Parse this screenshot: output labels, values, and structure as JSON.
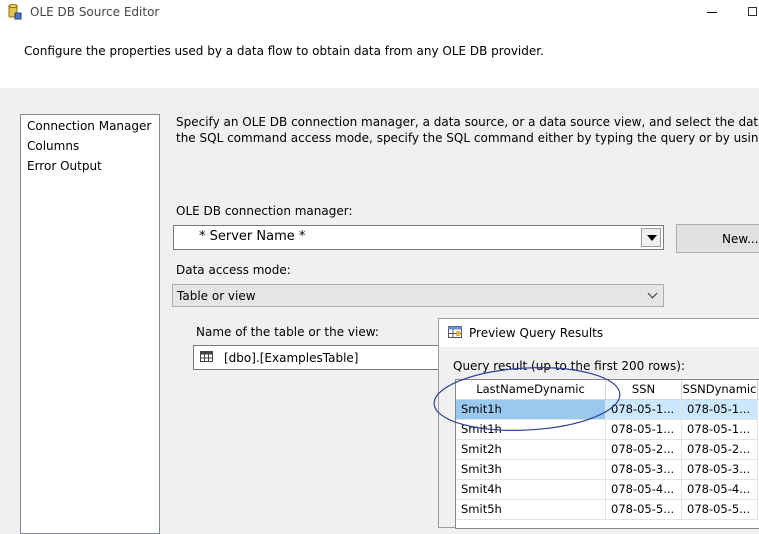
{
  "window": {
    "title": "OLE DB Source Editor"
  },
  "header": {
    "description": "Configure the properties used by a data flow to obtain data from any OLE DB provider."
  },
  "nav": {
    "items": [
      {
        "label": "Connection Manager"
      },
      {
        "label": "Columns"
      },
      {
        "label": "Error Output"
      }
    ]
  },
  "main": {
    "instructions_line1": "Specify an OLE DB connection manager, a data source, or a data source view, and select the data access mode.",
    "instructions_line2": "the SQL command access mode, specify the SQL command either by typing the query or by using Query Builde",
    "connection_label": "OLE DB connection manager:",
    "connection_value": "* Server Name *",
    "new_button": "New...",
    "mode_label": "Data access mode:",
    "mode_value": "Table or view",
    "table_label": "Name of the table or the view:",
    "table_value": "[dbo].[ExamplesTable]"
  },
  "preview": {
    "title": "Preview Query Results",
    "caption": "Query result (up to the first 200 rows):",
    "columns": [
      "LastNameDynamic",
      "SSN",
      "SSNDynamic"
    ],
    "rows": [
      [
        "Smit1h",
        "078-05-1...",
        "078-05-1..."
      ],
      [
        "Smit1h",
        "078-05-1...",
        "078-05-1..."
      ],
      [
        "Smit2h",
        "078-05-2...",
        "078-05-2..."
      ],
      [
        "Smit3h",
        "078-05-3...",
        "078-05-3..."
      ],
      [
        "Smit4h",
        "078-05-4...",
        "078-05-4..."
      ],
      [
        "Smit5h",
        "078-05-5...",
        "078-05-5..."
      ]
    ]
  },
  "colors": {
    "selection": "#cce8ff",
    "annotation": "#2b3f9e"
  }
}
